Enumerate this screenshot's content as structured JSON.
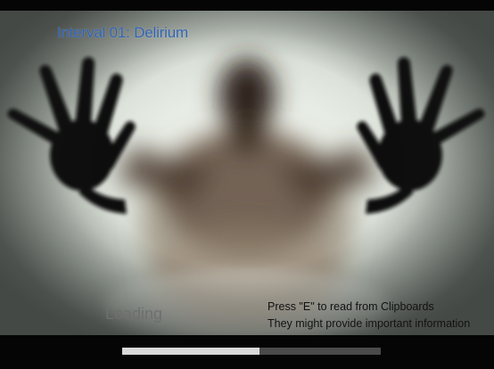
{
  "title": "Interval 01: Delirium",
  "loading": {
    "label": "Loading",
    "progress_fraction": 0.53
  },
  "hint": {
    "line1": "Press \"E\" to read from Clipboards",
    "line2": "They might provide important information"
  },
  "colors": {
    "title": "#2f63b4",
    "loading_text": "#6f6f6f",
    "hint_text": "#121212",
    "progress_fill": "#d9d9d9",
    "progress_track": "#4a4a4a",
    "background": "#050505"
  }
}
